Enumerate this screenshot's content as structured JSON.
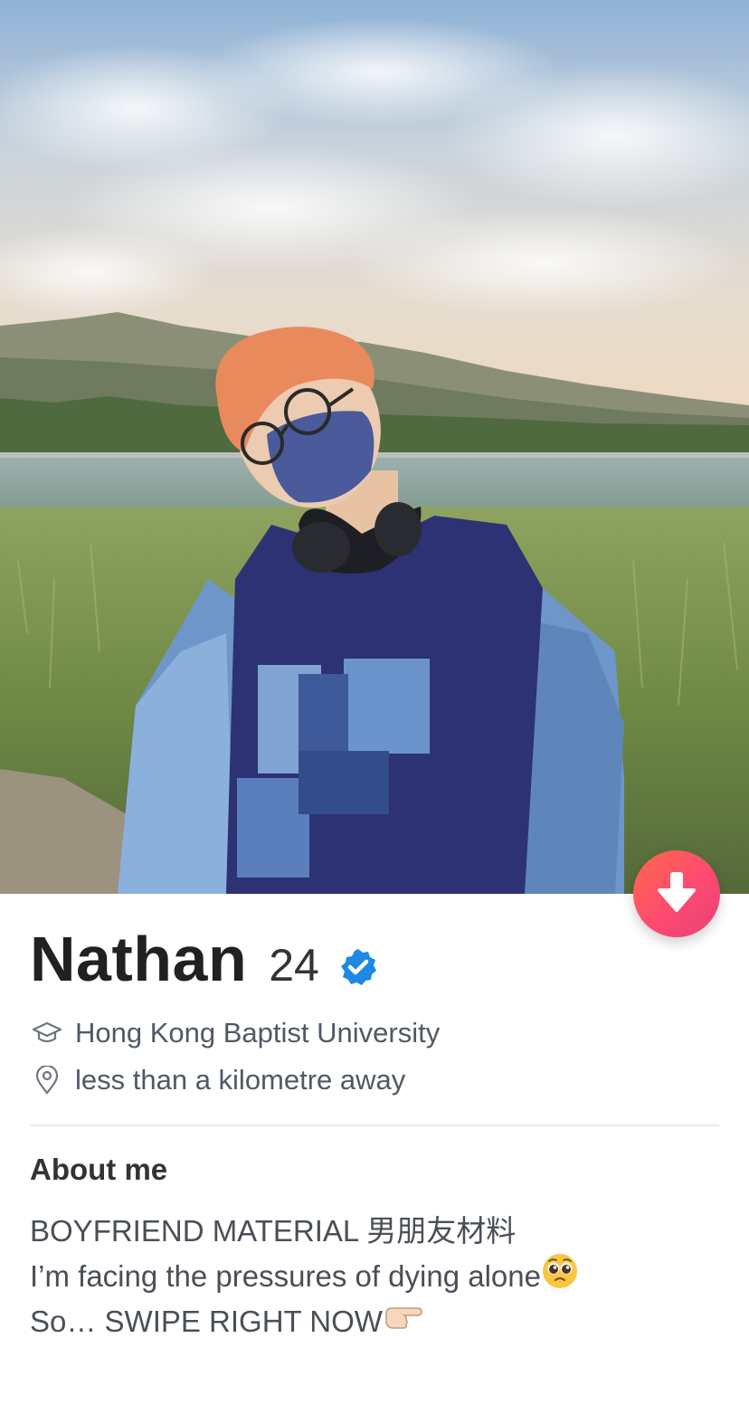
{
  "profile": {
    "name": "Nathan",
    "age": "24",
    "school": "Hong Kong Baptist University",
    "distance": "less than a kilometre away"
  },
  "about": {
    "title": "About me",
    "lines": [
      "BOYFRIEND MATERIAL 男朋友材料",
      "I’m facing the pressures of dying alone",
      "So… SWIPE RIGHT NOW"
    ]
  },
  "icons": {
    "verified": "verified-badge-icon",
    "school": "graduation-cap-icon",
    "distance": "location-pin-icon",
    "down": "arrow-down-icon"
  },
  "colors": {
    "accent_gradient_start": "#ff6b4a",
    "accent_gradient_end": "#e8417a",
    "verified_blue": "#1e88e5"
  }
}
